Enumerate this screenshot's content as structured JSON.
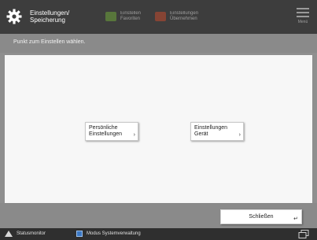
{
  "header": {
    "title_line1": "Einstellungen/",
    "title_line2": "Speicherung",
    "tab1_line1": "Einstellen",
    "tab1_line2": "Favoriten",
    "tab2_line1": "Einstellungen",
    "tab2_line2": "Übernehmen",
    "menu_label": "Menü"
  },
  "instruction": "Punkt zum Einstellen wählen.",
  "choices": {
    "personal_line1": "Persönliche",
    "personal_line2": "Einstellungen",
    "device_line1": "Einstellungen",
    "device_line2": "Gerät"
  },
  "actions": {
    "close_label": "Schließen"
  },
  "statusbar": {
    "monitor_label": "Statusmonitor",
    "admin_label": "Modus Systemverwaltung"
  },
  "colors": {
    "header_bg": "#3d3d3d",
    "tab1_icon": "#6fa63b",
    "tab2_icon": "#c24b2d",
    "panel_bg": "#f7f7f7",
    "admin_icon": "#3b78c4"
  }
}
